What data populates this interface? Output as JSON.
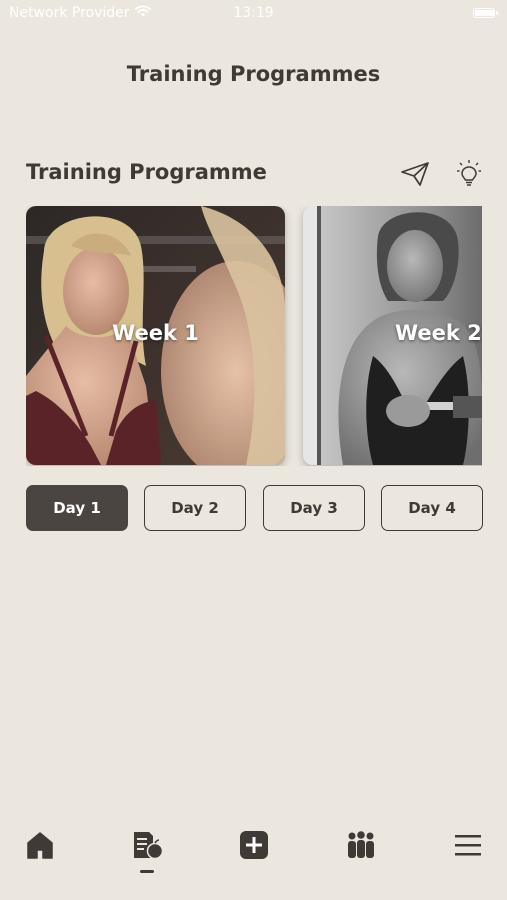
{
  "status_bar": {
    "carrier": "Network Provider",
    "time": "13:19",
    "icons": [
      "wifi-icon",
      "battery-icon"
    ]
  },
  "header": {
    "title": "Training Programmes"
  },
  "section": {
    "title": "Training Programme",
    "actions": [
      {
        "icon": "paper-plane-icon"
      },
      {
        "icon": "lightbulb-icon"
      }
    ]
  },
  "weeks": [
    {
      "label": "Week 1"
    },
    {
      "label": "Week 2"
    }
  ],
  "days": [
    {
      "label": "Day 1",
      "selected": true
    },
    {
      "label": "Day 2",
      "selected": false
    },
    {
      "label": "Day 3",
      "selected": false
    },
    {
      "label": "Day 4",
      "selected": false
    }
  ],
  "bottom_nav": {
    "items": [
      {
        "icon": "home-icon",
        "active": false
      },
      {
        "icon": "nutrition-document-icon",
        "active": true
      },
      {
        "icon": "add-square-icon",
        "active": false
      },
      {
        "icon": "community-icon",
        "active": false
      },
      {
        "icon": "menu-icon",
        "active": false
      }
    ]
  },
  "colors": {
    "background": "#ebe7df",
    "primary_text": "#3f3a36",
    "selected_tab": "#4a4541"
  }
}
